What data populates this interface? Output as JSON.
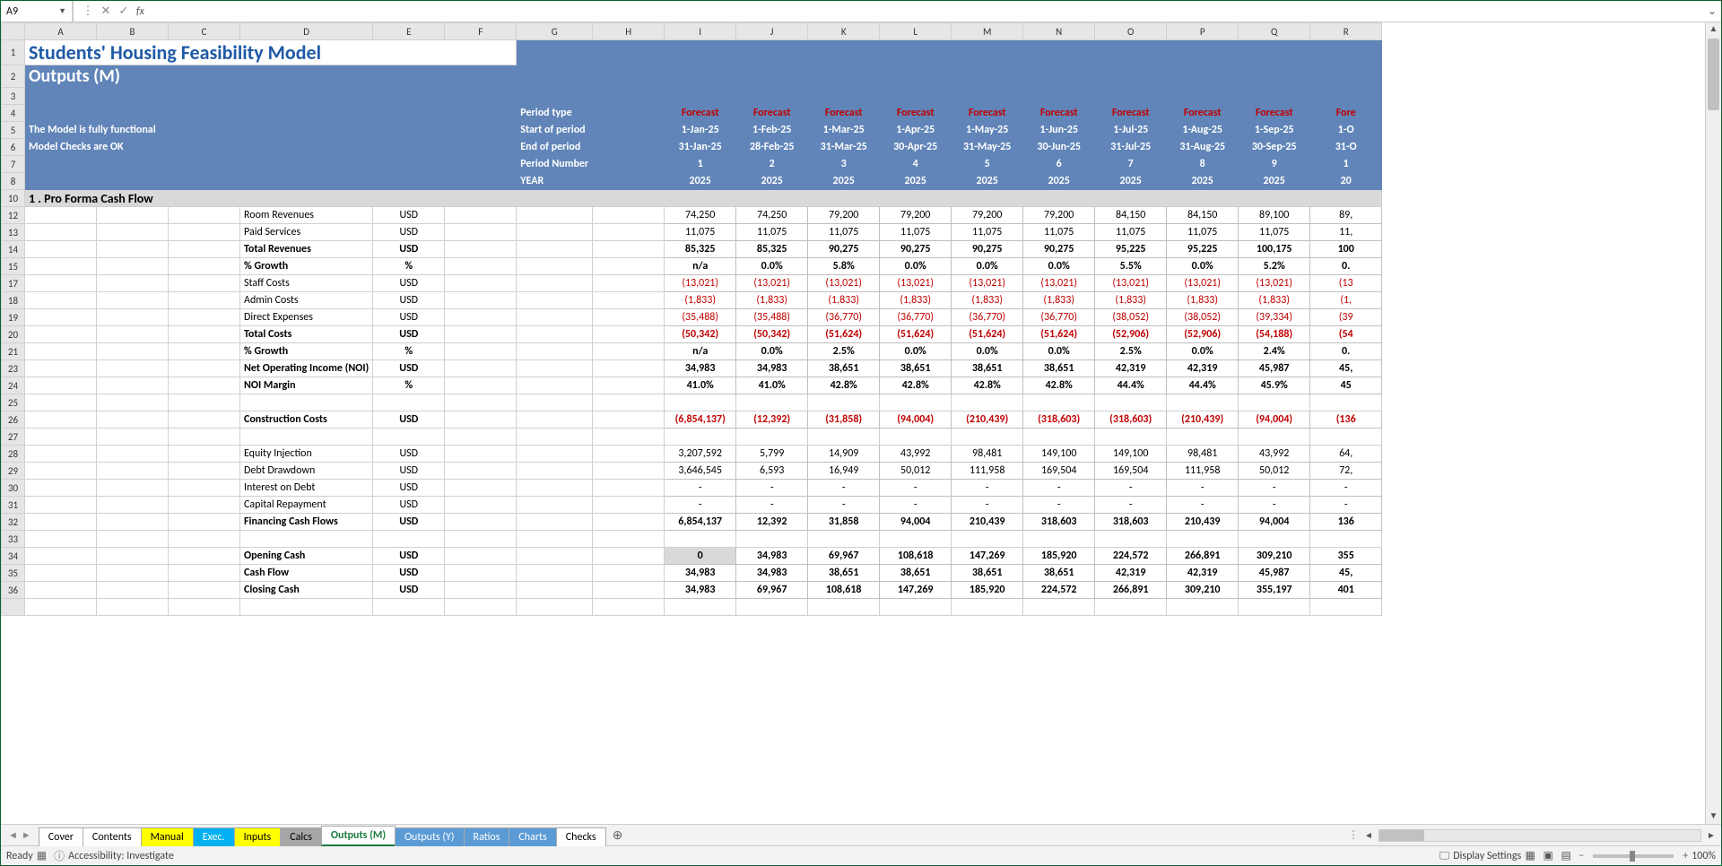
{
  "nameBox": "A9",
  "title": "Students' Housing Feasibility Model",
  "subtitle": "Outputs (M)",
  "status1": "The Model is fully functional",
  "status2": "Model Checks are OK",
  "periodLabels": {
    "type": "Period type",
    "start": "Start of period",
    "end": "End of period",
    "number": "Period Number",
    "year": "YEAR"
  },
  "cols": "ABCDEFGHIJKLMNOPQR",
  "periods": [
    {
      "fc": "Forecast",
      "start": "1-Jan-25",
      "end": "31-Jan-25",
      "num": "1",
      "year": "2025"
    },
    {
      "fc": "Forecast",
      "start": "1-Feb-25",
      "end": "28-Feb-25",
      "num": "2",
      "year": "2025"
    },
    {
      "fc": "Forecast",
      "start": "1-Mar-25",
      "end": "31-Mar-25",
      "num": "3",
      "year": "2025"
    },
    {
      "fc": "Forecast",
      "start": "1-Apr-25",
      "end": "30-Apr-25",
      "num": "4",
      "year": "2025"
    },
    {
      "fc": "Forecast",
      "start": "1-May-25",
      "end": "31-May-25",
      "num": "5",
      "year": "2025"
    },
    {
      "fc": "Forecast",
      "start": "1-Jun-25",
      "end": "30-Jun-25",
      "num": "6",
      "year": "2025"
    },
    {
      "fc": "Forecast",
      "start": "1-Jul-25",
      "end": "31-Jul-25",
      "num": "7",
      "year": "2025"
    },
    {
      "fc": "Forecast",
      "start": "1-Aug-25",
      "end": "31-Aug-25",
      "num": "8",
      "year": "2025"
    },
    {
      "fc": "Forecast",
      "start": "1-Sep-25",
      "end": "30-Sep-25",
      "num": "9",
      "year": "2025"
    },
    {
      "fc": "Fore",
      "start": "1-O",
      "end": "31-O",
      "num": "1",
      "year": "20"
    }
  ],
  "section1": "1 . Pro Forma Cash Flow",
  "rowNums": [
    "1",
    "2",
    "3",
    "4",
    "5",
    "6",
    "7",
    "8",
    "10",
    "12",
    "13",
    "14",
    "15",
    "17",
    "18",
    "19",
    "20",
    "21",
    "23",
    "24",
    "25",
    "26",
    "27",
    "28",
    "29",
    "30",
    "31",
    "32",
    "33",
    "34",
    "35",
    "36"
  ],
  "rows": [
    {
      "label": "Room Revenues",
      "unit": "USD",
      "bold": false,
      "vals": [
        "74,250",
        "74,250",
        "79,200",
        "79,200",
        "79,200",
        "79,200",
        "84,150",
        "84,150",
        "89,100",
        "89,"
      ]
    },
    {
      "label": "Paid Services",
      "unit": "USD",
      "bold": false,
      "vals": [
        "11,075",
        "11,075",
        "11,075",
        "11,075",
        "11,075",
        "11,075",
        "11,075",
        "11,075",
        "11,075",
        "11,"
      ]
    },
    {
      "label": "Total Revenues",
      "unit": "USD",
      "bold": true,
      "vals": [
        "85,325",
        "85,325",
        "90,275",
        "90,275",
        "90,275",
        "90,275",
        "95,225",
        "95,225",
        "100,175",
        "100"
      ]
    },
    {
      "label": "% Growth",
      "unit": "%",
      "bold": true,
      "vals": [
        "n/a",
        "0.0%",
        "5.8%",
        "0.0%",
        "0.0%",
        "0.0%",
        "5.5%",
        "0.0%",
        "5.2%",
        "0."
      ]
    },
    {
      "label": "Staff Costs",
      "unit": "USD",
      "bold": false,
      "neg": true,
      "vals": [
        "(13,021)",
        "(13,021)",
        "(13,021)",
        "(13,021)",
        "(13,021)",
        "(13,021)",
        "(13,021)",
        "(13,021)",
        "(13,021)",
        "(13"
      ]
    },
    {
      "label": "Admin Costs",
      "unit": "USD",
      "bold": false,
      "neg": true,
      "vals": [
        "(1,833)",
        "(1,833)",
        "(1,833)",
        "(1,833)",
        "(1,833)",
        "(1,833)",
        "(1,833)",
        "(1,833)",
        "(1,833)",
        "(1,"
      ]
    },
    {
      "label": "Direct Expenses",
      "unit": "USD",
      "bold": false,
      "neg": true,
      "vals": [
        "(35,488)",
        "(35,488)",
        "(36,770)",
        "(36,770)",
        "(36,770)",
        "(36,770)",
        "(38,052)",
        "(38,052)",
        "(39,334)",
        "(39"
      ]
    },
    {
      "label": "Total Costs",
      "unit": "USD",
      "bold": true,
      "neg": true,
      "vals": [
        "(50,342)",
        "(50,342)",
        "(51,624)",
        "(51,624)",
        "(51,624)",
        "(51,624)",
        "(52,906)",
        "(52,906)",
        "(54,188)",
        "(54"
      ]
    },
    {
      "label": "% Growth",
      "unit": "%",
      "bold": true,
      "vals": [
        "n/a",
        "0.0%",
        "2.5%",
        "0.0%",
        "0.0%",
        "0.0%",
        "2.5%",
        "0.0%",
        "2.4%",
        "0."
      ]
    },
    {
      "label": "Net Operating Income (NOI)",
      "unit": "USD",
      "bold": true,
      "vals": [
        "34,983",
        "34,983",
        "38,651",
        "38,651",
        "38,651",
        "38,651",
        "42,319",
        "42,319",
        "45,987",
        "45,"
      ]
    },
    {
      "label": "NOI Margin",
      "unit": "%",
      "bold": true,
      "vals": [
        "41.0%",
        "41.0%",
        "42.8%",
        "42.8%",
        "42.8%",
        "42.8%",
        "44.4%",
        "44.4%",
        "45.9%",
        "45"
      ]
    },
    {
      "blank": true
    },
    {
      "label": "Construction Costs",
      "unit": "USD",
      "bold": true,
      "neg": true,
      "vals": [
        "(6,854,137)",
        "(12,392)",
        "(31,858)",
        "(94,004)",
        "(210,439)",
        "(318,603)",
        "(318,603)",
        "(210,439)",
        "(94,004)",
        "(136"
      ]
    },
    {
      "blank": true
    },
    {
      "label": "Equity Injection",
      "unit": "USD",
      "bold": false,
      "vals": [
        "3,207,592",
        "5,799",
        "14,909",
        "43,992",
        "98,481",
        "149,100",
        "149,100",
        "98,481",
        "43,992",
        "64,"
      ]
    },
    {
      "label": "Debt Drawdown",
      "unit": "USD",
      "bold": false,
      "vals": [
        "3,646,545",
        "6,593",
        "16,949",
        "50,012",
        "111,958",
        "169,504",
        "169,504",
        "111,958",
        "50,012",
        "72,"
      ]
    },
    {
      "label": "Interest on Debt",
      "unit": "USD",
      "bold": false,
      "vals": [
        "-",
        "-",
        "-",
        "-",
        "-",
        "-",
        "-",
        "-",
        "-",
        "-"
      ]
    },
    {
      "label": "Capital Repayment",
      "unit": "USD",
      "bold": false,
      "vals": [
        "-",
        "-",
        "-",
        "-",
        "-",
        "-",
        "-",
        "-",
        "-",
        "-"
      ]
    },
    {
      "label": "Financing Cash Flows",
      "unit": "USD",
      "bold": true,
      "vals": [
        "6,854,137",
        "12,392",
        "31,858",
        "94,004",
        "210,439",
        "318,603",
        "318,603",
        "210,439",
        "94,004",
        "136"
      ]
    },
    {
      "blank": true
    },
    {
      "label": "Opening Cash",
      "unit": "USD",
      "bold": true,
      "vals": [
        "0",
        "34,983",
        "69,967",
        "108,618",
        "147,269",
        "185,920",
        "224,572",
        "266,891",
        "309,210",
        "355"
      ],
      "shadeFirst": true
    },
    {
      "label": "Cash Flow",
      "unit": "USD",
      "bold": true,
      "vals": [
        "34,983",
        "34,983",
        "38,651",
        "38,651",
        "38,651",
        "38,651",
        "42,319",
        "42,319",
        "45,987",
        "45,"
      ]
    },
    {
      "label": "Closing Cash",
      "unit": "USD",
      "bold": true,
      "vals": [
        "34,983",
        "69,967",
        "108,618",
        "147,269",
        "185,920",
        "224,572",
        "266,891",
        "309,210",
        "355,197",
        "401"
      ]
    }
  ],
  "tabs": [
    {
      "label": "Cover",
      "cls": ""
    },
    {
      "label": "Contents",
      "cls": ""
    },
    {
      "label": "Manual",
      "cls": "yellow"
    },
    {
      "label": "Exec.",
      "cls": "cyan"
    },
    {
      "label": "Inputs",
      "cls": "yellow"
    },
    {
      "label": "Calcs",
      "cls": "gray"
    },
    {
      "label": "Outputs (M)",
      "cls": "active"
    },
    {
      "label": "Outputs (Y)",
      "cls": "blue"
    },
    {
      "label": "Ratios",
      "cls": "blue"
    },
    {
      "label": "Charts",
      "cls": "blue"
    },
    {
      "label": "Checks",
      "cls": ""
    }
  ],
  "status": {
    "ready": "Ready",
    "acc": "Accessibility: Investigate",
    "display": "Display Settings",
    "zoom": "100%"
  }
}
